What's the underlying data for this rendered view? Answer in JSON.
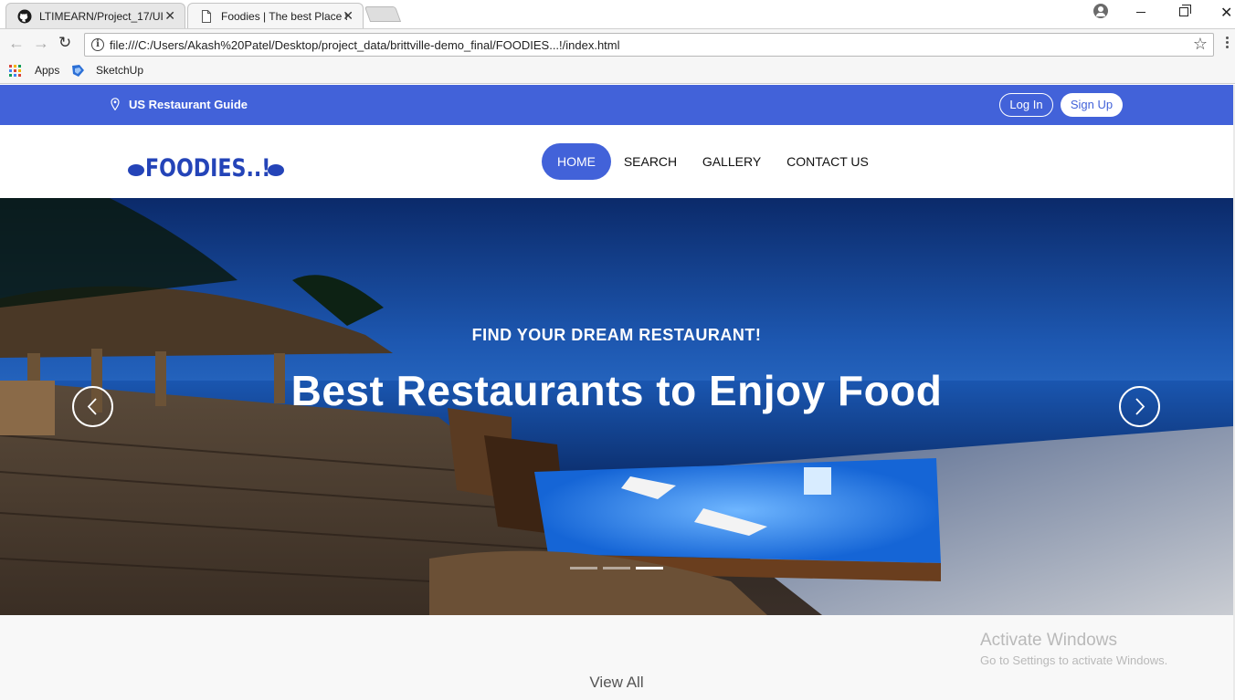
{
  "browser": {
    "tabs": [
      {
        "title": "LTIMEARN/Project_17/UI",
        "icon": "github-icon",
        "active": false
      },
      {
        "title": "Foodies | The best Place t",
        "icon": "page-icon",
        "active": true
      }
    ],
    "address_url": "file:///C:/Users/Akash%20Patel/Desktop/project_data/brittville-demo_final/FOODIES...!/index.html",
    "bookmarks": [
      {
        "label": "Apps",
        "icon": "apps-grid-icon"
      },
      {
        "label": "SketchUp",
        "icon": "sketchup-icon"
      }
    ]
  },
  "topbar": {
    "location_label": "US Restaurant Guide",
    "login_label": "Log In",
    "signup_label": "Sign Up",
    "bg_color": "#4262d9"
  },
  "header": {
    "logo_text": "FOODIES..!",
    "nav": [
      {
        "label": "HOME",
        "active": true
      },
      {
        "label": "SEARCH",
        "active": false
      },
      {
        "label": "GALLERY",
        "active": false
      },
      {
        "label": "CONTACT US",
        "active": false
      }
    ]
  },
  "hero": {
    "subtitle": "FIND YOUR DREAM RESTAURANT!",
    "title": "Best Restaurants to Enjoy Food",
    "slide_count": 3,
    "active_slide": 3
  },
  "lower": {
    "view_all_label": "View All"
  },
  "watermark": {
    "title": "Activate Windows",
    "subtitle": "Go to Settings to activate Windows."
  }
}
